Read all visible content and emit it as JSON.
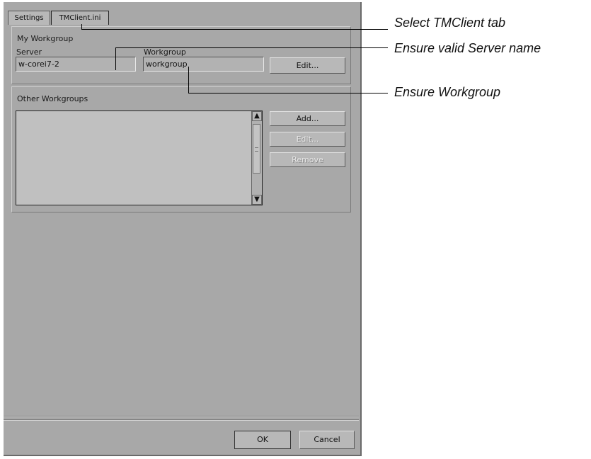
{
  "tabs": [
    {
      "label": "Settings",
      "active": false
    },
    {
      "label": "TMClient.ini",
      "active": true
    }
  ],
  "my_workgroup": {
    "title": "My Workgroup",
    "server_label": "Server",
    "server_value": "w-corei7-2",
    "workgroup_label": "Workgroup",
    "workgroup_value": "workgroup",
    "edit_label": "Edit..."
  },
  "other_workgroups": {
    "title": "Other Workgroups",
    "items": [],
    "add_label": "Add...",
    "edit_label": "Edit...",
    "remove_label": "Remove"
  },
  "footer": {
    "ok_label": "OK",
    "cancel_label": "Cancel"
  },
  "annotations": {
    "select_tab": "Select TMClient tab",
    "server_name": "Ensure valid Server name",
    "workgroup": "Ensure Workgroup"
  },
  "colors": {
    "dialog_bg": "#a8a8a8",
    "annotation_text": "#111111"
  }
}
